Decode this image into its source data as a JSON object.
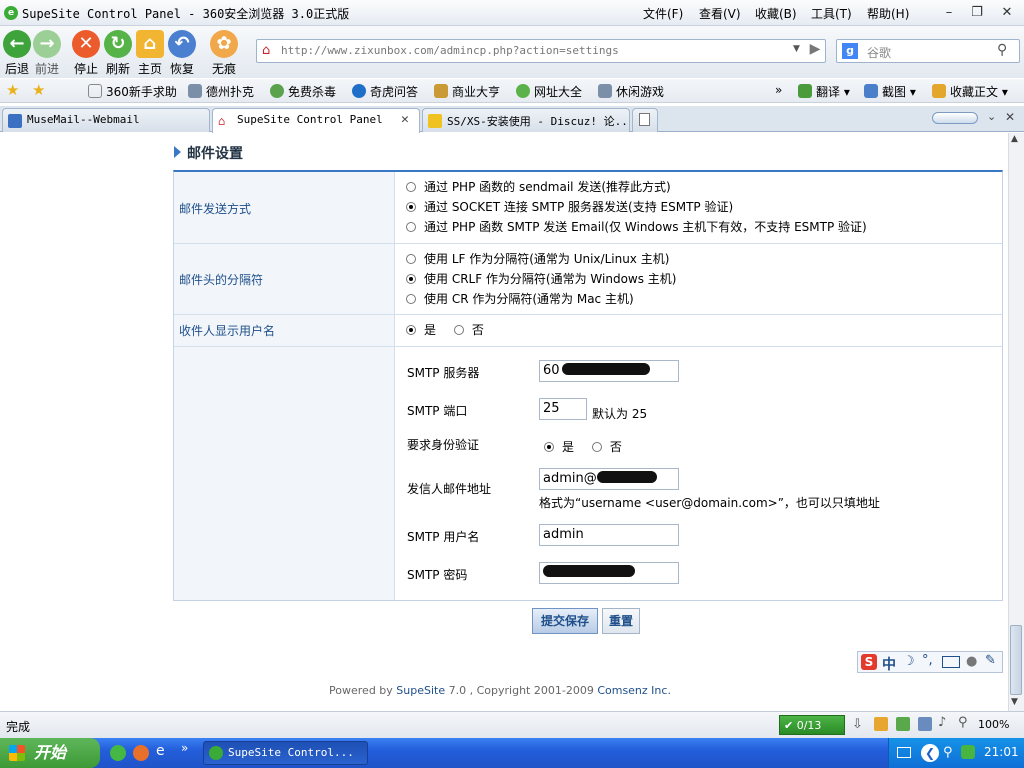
{
  "window": {
    "title": "SupeSite Control Panel - 360安全浏览器 3.0正式版",
    "menu": [
      "文件(F)",
      "查看(V)",
      "收藏(B)",
      "工具(T)",
      "帮助(H)"
    ]
  },
  "toolbar": {
    "back": "后退",
    "forward": "前进",
    "stop": "停止",
    "refresh": "刷新",
    "home": "主页",
    "restore": "恢复",
    "incognito": "无痕",
    "url": "http://www.zixunbox.com/admincp.php?action=settings",
    "search_placeholder": "谷歌"
  },
  "favorites": {
    "items": [
      "360新手求助",
      "德州扑克",
      "免费杀毒",
      "奇虎问答",
      "商业大亨",
      "网址大全",
      "休闲游戏"
    ],
    "more": "»",
    "translate": "翻译",
    "screenshot": "截图",
    "collect": "收藏正文"
  },
  "tabs": [
    {
      "label": "MuseMail--Webmail"
    },
    {
      "label": "SupeSite Control Panel"
    },
    {
      "label": "SS/XS-安装使用 - Discuz! 论..."
    }
  ],
  "section": {
    "title": "邮件设置"
  },
  "form": {
    "send_method": {
      "label": "邮件发送方式",
      "options": [
        "通过 PHP 函数的 sendmail 发送(推荐此方式)",
        "通过 SOCKET 连接 SMTP 服务器发送(支持 ESMTP 验证)",
        "通过 PHP 函数 SMTP 发送 Email(仅 Windows 主机下有效，不支持 ESMTP 验证)"
      ]
    },
    "header_sep": {
      "label": "邮件头的分隔符",
      "options": [
        "使用 LF 作为分隔符(通常为 Unix/Linux 主机)",
        "使用 CRLF 作为分隔符(通常为 Windows 主机)",
        "使用 CR 作为分隔符(通常为 Mac 主机)"
      ]
    },
    "show_username": {
      "label": "收件人显示用户名",
      "yes": "是",
      "no": "否"
    },
    "smtp": {
      "server_label": "SMTP 服务器",
      "server_value": "60",
      "port_label": "SMTP 端口",
      "port_value": "25",
      "port_hint": "默认为 25",
      "auth_label": "要求身份验证",
      "auth_yes": "是",
      "auth_no": "否",
      "from_label": "发信人邮件地址",
      "from_value": "admin@",
      "from_hint": "格式为“username <user@domain.com>”，也可以只填地址",
      "user_label": "SMTP 用户名",
      "user_value": "admin",
      "pass_label": "SMTP 密码"
    }
  },
  "buttons": {
    "submit": "提交保存",
    "reset": "重置"
  },
  "footer": {
    "prefix": "Powered by",
    "brand": "SupeSite",
    "version": "7.0 , Copyright 2001-2009",
    "company": "Comsenz Inc."
  },
  "ime": {
    "zh": "中"
  },
  "status": {
    "text": "完成",
    "count": "0/13",
    "zoom": "100%"
  },
  "taskbar": {
    "start": "开始",
    "task": "SupeSite Control...",
    "clock": "21:01"
  }
}
